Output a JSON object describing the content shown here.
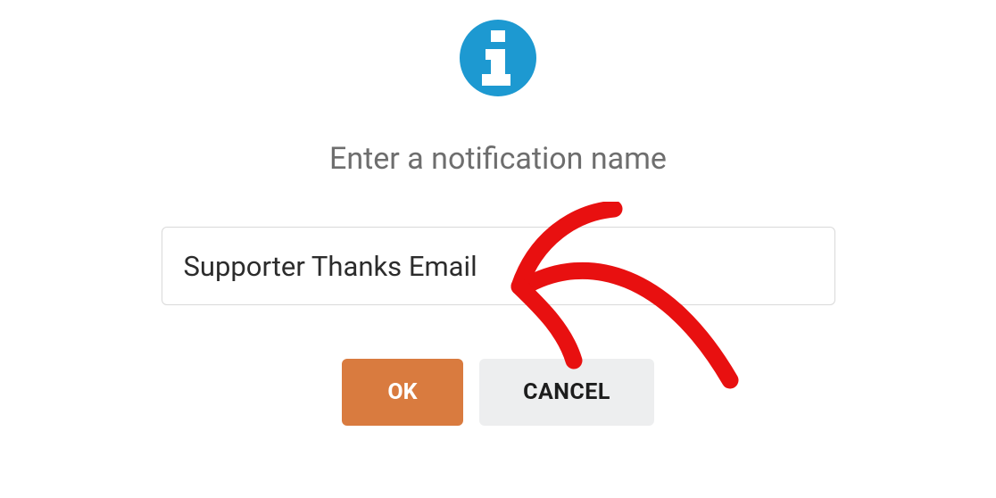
{
  "dialog": {
    "prompt": "Enter a notification name",
    "input_value": "Supporter Thanks Email",
    "ok_label": "OK",
    "cancel_label": "CANCEL"
  }
}
